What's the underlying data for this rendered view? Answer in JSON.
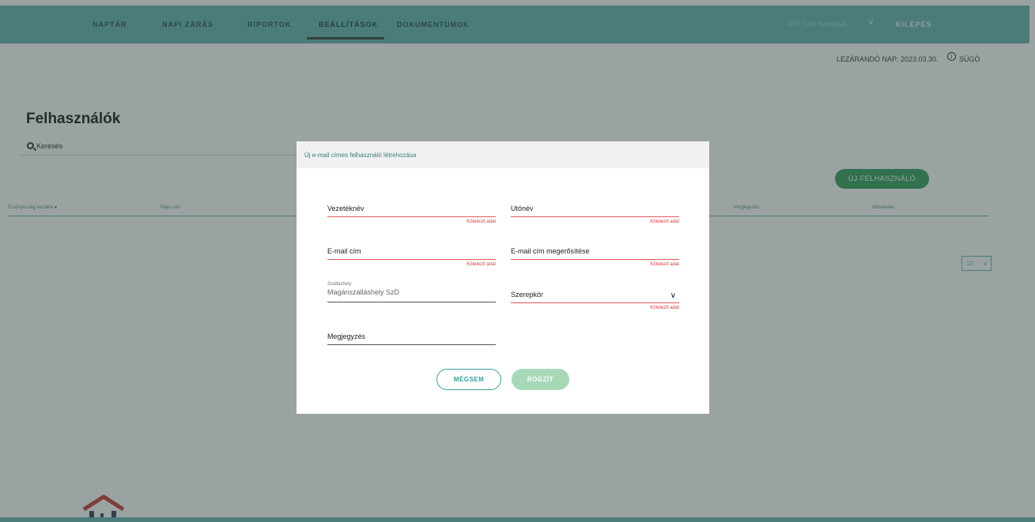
{
  "nav": {
    "items": [
      "NAPTÁR",
      "NAPI ZÁRÁS",
      "RIPORTOK",
      "BEÁLLÍTÁSOK",
      "DOKUMENTUMOK"
    ],
    "active_index": 3,
    "user": "UAT Teszt Szolgáltat... - ...",
    "logout": "KILÉPÉS"
  },
  "subheader": {
    "closing_day": "LEZÁRANDÓ NAP: 2023.03.30.",
    "help": "SÚGÓ"
  },
  "page": {
    "title": "Felhasználók",
    "search_label": "Keresés",
    "new_user_button": "ÚJ FELHASZNÁLÓ",
    "page_size": "10"
  },
  "table": {
    "headers": [
      "Érvényesség kezdete",
      "Teljes név",
      "Megjegyzés",
      "Műveletek"
    ]
  },
  "modal": {
    "title": "Új e-mail címes felhasználó létrehozása",
    "fields": {
      "lastname": {
        "label": "Vezetéknév",
        "error": "Kötelező adat"
      },
      "firstname": {
        "label": "Utónév",
        "error": "Kötelező adat"
      },
      "email": {
        "label": "E-mail cím",
        "error": "Kötelező adat"
      },
      "email_confirm": {
        "label": "E-mail cím megerősítése",
        "error": "Kötelező adat"
      },
      "accommodation": {
        "label": "Szálláshely",
        "value": "Magánszálláshely SzD"
      },
      "role": {
        "label": "Szerepkör",
        "error": "Kötelező adat"
      },
      "note": {
        "label": "Megjegyzés"
      }
    },
    "cancel_button": "MÉGSEM",
    "save_button": "RÖGZÍT"
  },
  "colors": {
    "primary": "#5fb3ae",
    "accent_green": "#2a9d55",
    "error": "#d43c3c"
  }
}
